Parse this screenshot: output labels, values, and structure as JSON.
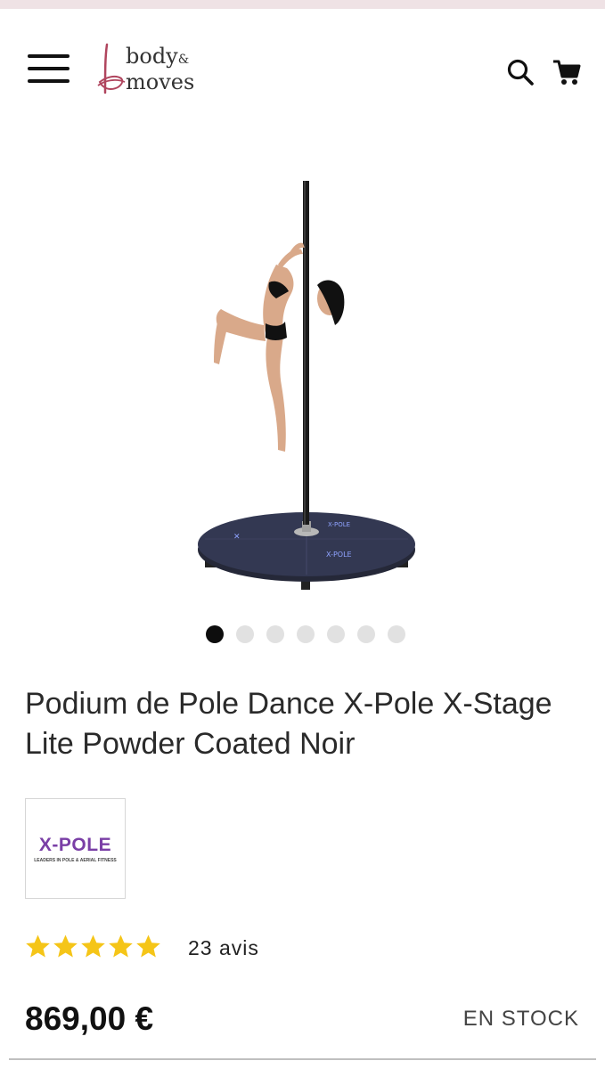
{
  "header": {
    "logo_line1": "body",
    "logo_amp": "&",
    "logo_line2": "moves"
  },
  "carousel": {
    "count": 7,
    "active_index": 0
  },
  "product": {
    "title": "Podium de Pole Dance X-Pole X-Stage Lite Powder Coated Noir",
    "brand_name": "X-POLE",
    "brand_tagline": "LEADERS IN POLE & AERIAL FITNESS",
    "rating": 5,
    "rating_max": 5,
    "review_count_label": "23 avis",
    "price": "869,00 €",
    "stock_status": "EN STOCK"
  },
  "colors": {
    "top_strip": "#efe2e5",
    "logo_accent": "#b0455e",
    "star": "#f5c518",
    "brand_purple": "#7a3fa6",
    "active_dot": "#0d0d0d",
    "inactive_dot": "#e1e1e1"
  },
  "icons": {
    "menu": "hamburger-menu-icon",
    "search": "search-icon",
    "cart": "shopping-cart-icon"
  }
}
